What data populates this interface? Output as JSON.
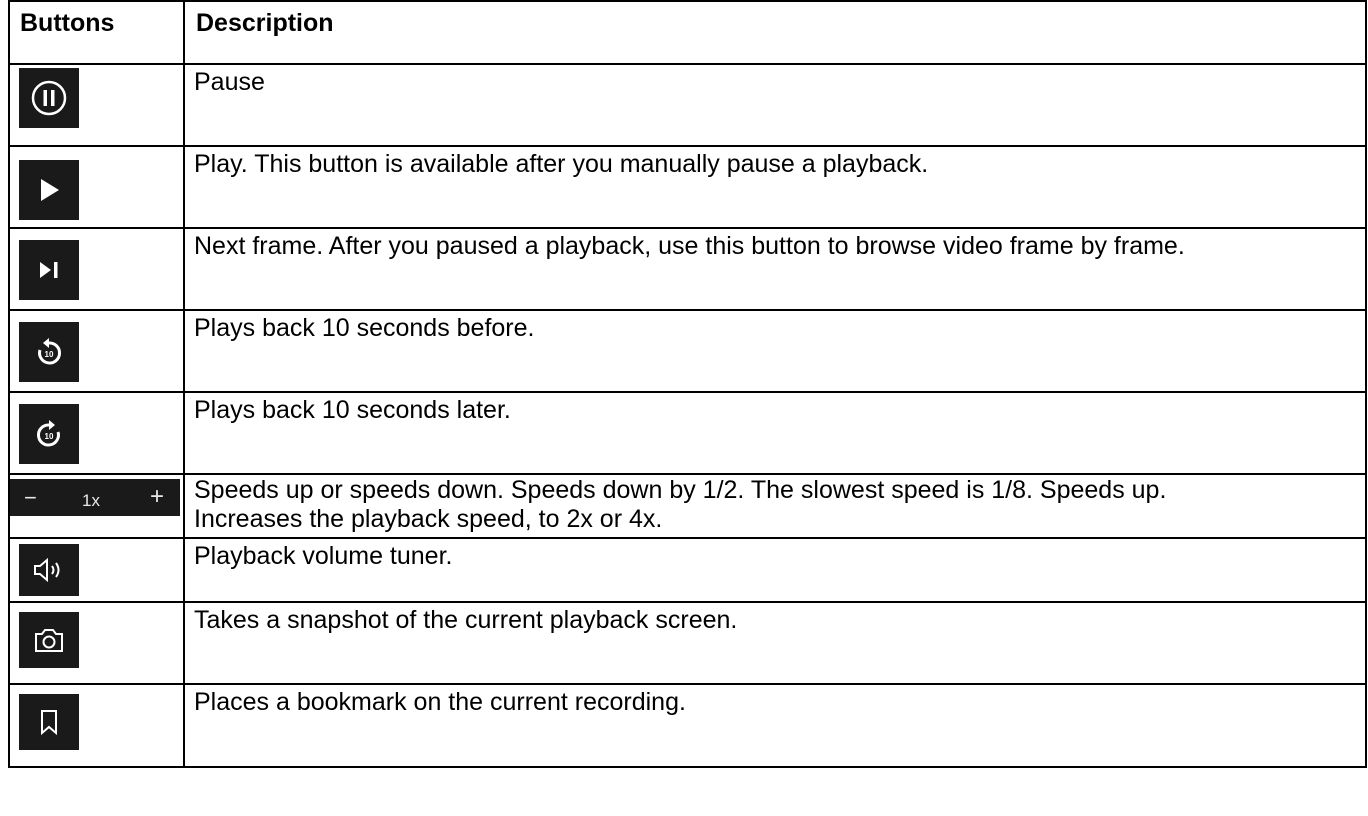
{
  "table": {
    "headers": {
      "buttons": "Buttons",
      "description": "Description"
    },
    "rows": [
      {
        "icon": "pause-icon",
        "description": "Pause"
      },
      {
        "icon": "play-icon",
        "description": "Play. This button is available after you manually pause a playback."
      },
      {
        "icon": "next-frame-icon",
        "description": "Next frame. After you paused a playback, use this button to browse video frame by frame."
      },
      {
        "icon": "rewind-10-icon",
        "description": "Plays back 10 seconds before."
      },
      {
        "icon": "forward-10-icon",
        "description": "Plays back 10 seconds later."
      },
      {
        "icon": "speed-control",
        "description": "Speeds up or speeds down. Speeds down by 1/2. The slowest speed is 1/8. Speeds up. Increases the playback speed, to 2x or 4x."
      },
      {
        "icon": "volume-icon",
        "description": "Playback volume tuner."
      },
      {
        "icon": "camera-icon",
        "description": "Takes a snapshot of the current playback screen."
      },
      {
        "icon": "bookmark-icon",
        "description": "Places a bookmark on the current recording."
      }
    ],
    "speed_control": {
      "minus": "−",
      "value": "1x",
      "plus": "+"
    }
  },
  "colors": {
    "button_bg": "#1a1a1a",
    "icon_fg": "#ffffff",
    "border": "#000000"
  }
}
